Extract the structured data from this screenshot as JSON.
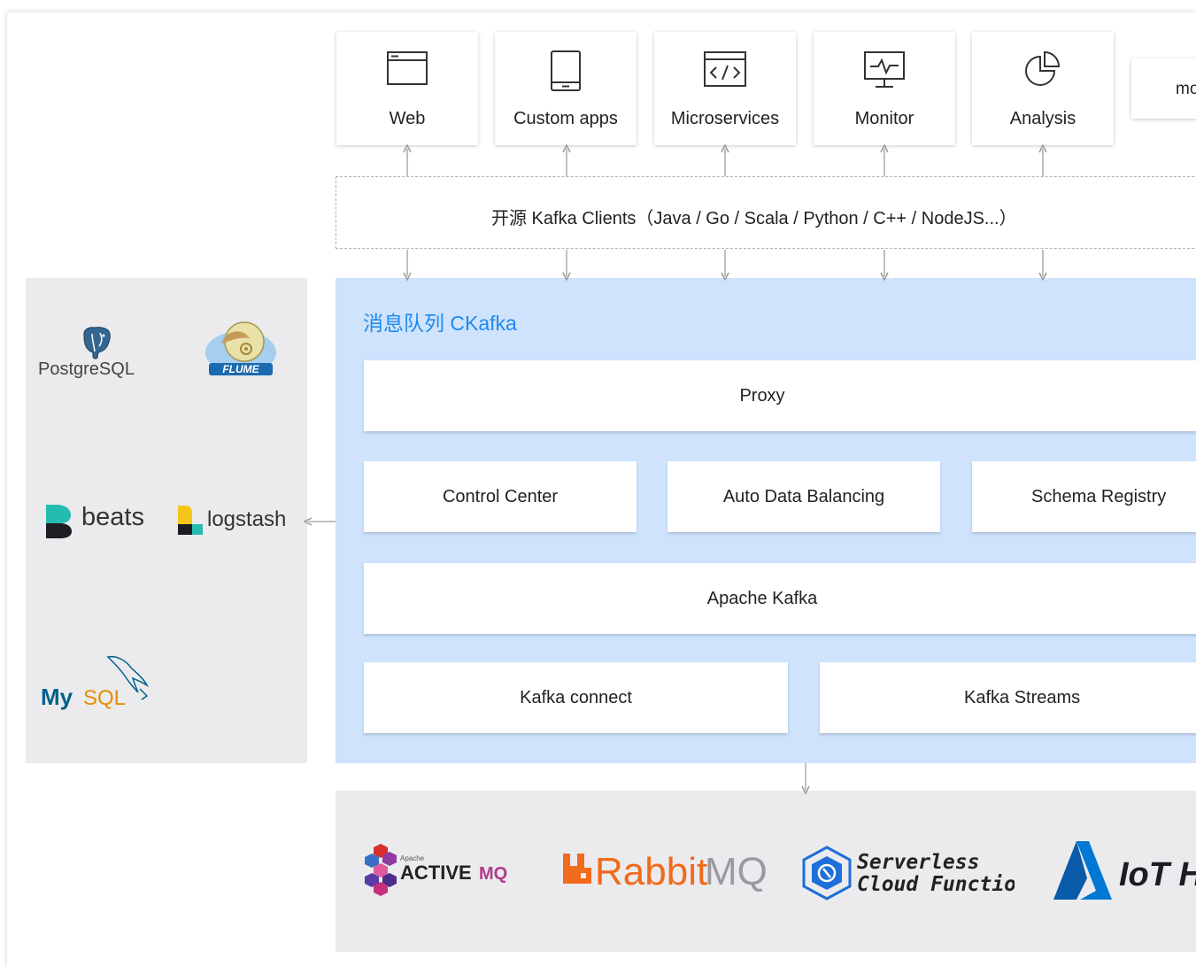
{
  "apps": [
    {
      "label": "Web",
      "icon": "browser-window-icon"
    },
    {
      "label": "Custom apps",
      "icon": "mobile-phone-icon"
    },
    {
      "label": "Microservices",
      "icon": "code-window-icon"
    },
    {
      "label": "Monitor",
      "icon": "monitor-icon"
    },
    {
      "label": "Analysis",
      "icon": "pie-chart-icon"
    }
  ],
  "more_label": "more",
  "clients_label": "开源 Kafka Clients（Java / Go / Scala / Python / C++ / NodeJS...）",
  "ckafka": {
    "title": "消息队列 CKafka",
    "proxy": "Proxy",
    "control_center": "Control Center",
    "auto_data_balancing": "Auto Data Balancing",
    "schema_registry": "Schema Registry",
    "apache_kafka": "Apache Kafka",
    "kafka_connect": "Kafka connect",
    "kafka_streams": "Kafka Streams"
  },
  "left_logos": {
    "postgresql": "PostgreSQL",
    "flume": "FLUME",
    "beats": "beats",
    "logstash": "logstash",
    "mysql_my": "My",
    "mysql_sql": "SQL"
  },
  "bottom_logos": {
    "activemq_apache": "Apache",
    "activemq_active": "ACTIVE",
    "activemq_mq": "MQ",
    "rabbit": "Rabbit",
    "rabbit_mq": "MQ",
    "scf_line1": "Serverless",
    "scf_line2": "Cloud Function",
    "iot": "IoT H"
  },
  "colors": {
    "ckafka_bg": "#cfe3fd",
    "ckafka_title": "#1e8af0",
    "panel_bg": "#ebebed",
    "rabbit_orange": "#f26a1b",
    "scf_blue": "#1e6fd9",
    "azure_blue": "#0078d4",
    "mysql_blue": "#00618a",
    "mysql_orange": "#e48e00"
  }
}
